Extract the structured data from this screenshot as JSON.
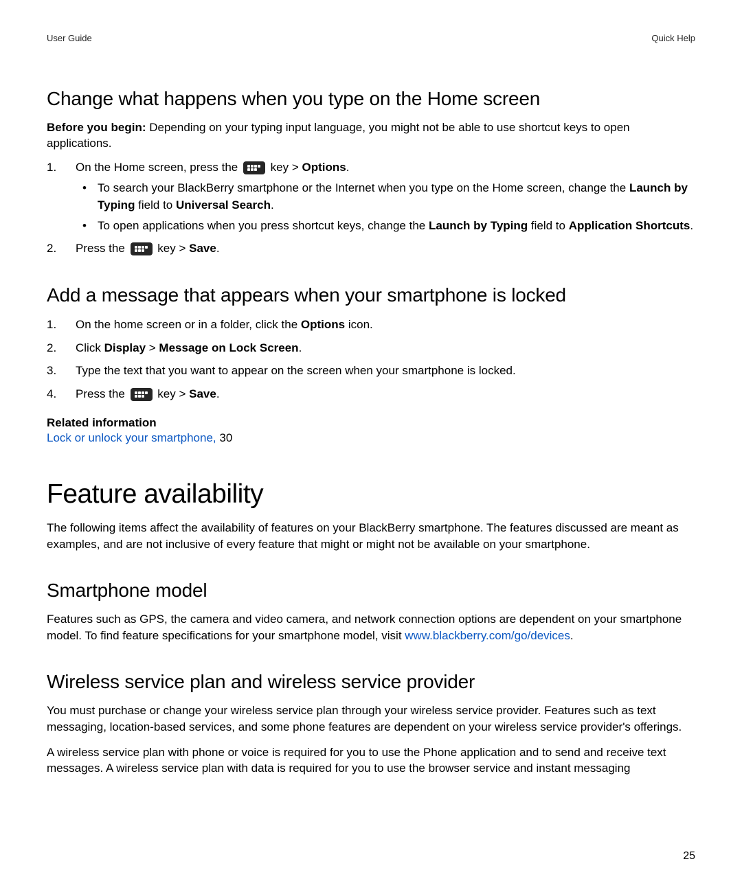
{
  "header": {
    "left": "User Guide",
    "right": "Quick Help"
  },
  "sec1": {
    "title": "Change what happens when you type on the Home screen",
    "before_bold": "Before you begin: ",
    "before_rest": "Depending on your typing input language, you might not be able to use shortcut keys to open applications.",
    "step1_a": "On the Home screen, press the ",
    "step1_b": " key > ",
    "step1_c": "Options",
    "step1_d": ".",
    "bullet1_a": "To search your BlackBerry smartphone or the Internet when you type on the Home screen, change the ",
    "bullet1_b": "Launch by Typing",
    "bullet1_c": " field to ",
    "bullet1_d": "Universal Search",
    "bullet1_e": ".",
    "bullet2_a": "To open applications when you press shortcut keys, change the ",
    "bullet2_b": "Launch by Typing",
    "bullet2_c": " field to ",
    "bullet2_d": "Application Shortcuts",
    "bullet2_e": ".",
    "step2_a": "Press the ",
    "step2_b": " key > ",
    "step2_c": "Save",
    "step2_d": "."
  },
  "sec2": {
    "title": "Add a message that appears when your smartphone is locked",
    "s1_a": "On the home screen or in a folder, click the ",
    "s1_b": "Options",
    "s1_c": " icon.",
    "s2_a": "Click ",
    "s2_b": "Display",
    "s2_c": " > ",
    "s2_d": "Message on Lock Screen",
    "s2_e": ".",
    "s3": "Type the text that you want to appear on the screen when your smartphone is locked.",
    "s4_a": "Press the ",
    "s4_b": " key > ",
    "s4_c": "Save",
    "s4_d": ".",
    "related_head": "Related information",
    "related_link": "Lock or unlock your smartphone, ",
    "related_pg": "30"
  },
  "feat": {
    "title": "Feature availability",
    "intro": "The following items affect the availability of features on your BlackBerry smartphone. The features discussed are meant as examples, and are not inclusive of every feature that might or might not be available on your smartphone."
  },
  "sec3": {
    "title": "Smartphone model",
    "p_a": "Features such as GPS, the camera and video camera, and network connection options are dependent on your smartphone model. To find feature specifications for your smartphone model, visit ",
    "link": "www.blackberry.com/go/devices",
    "p_b": "."
  },
  "sec4": {
    "title": "Wireless service plan and wireless service provider",
    "p1": "You must purchase or change your wireless service plan through your wireless service provider. Features such as text messaging, location-based services, and some phone features are dependent on your wireless service provider's offerings.",
    "p2": "A wireless service plan with phone or voice is required for you to use the Phone application and to send and receive text messages. A wireless service plan with data is required for you to use the browser service and instant messaging"
  },
  "page_number": "25"
}
